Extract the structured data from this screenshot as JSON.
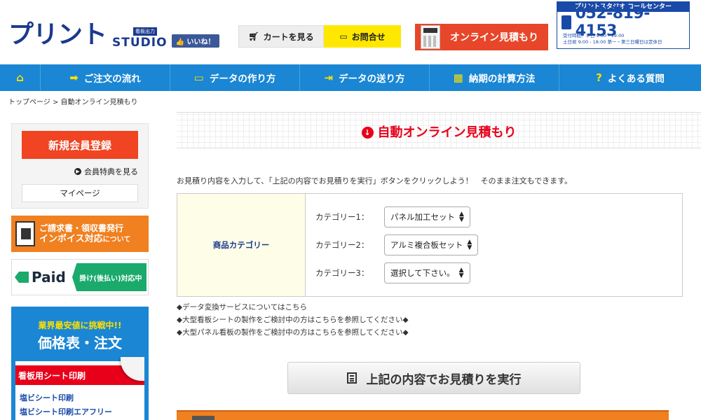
{
  "header": {
    "logo_text": "プリント",
    "logo_badge": "看板出力",
    "logo_studio": "STUDIO",
    "like_label": "いいね！",
    "cart_label": "カートを見る",
    "contact_label": "お問合せ",
    "quote_label": "オンライン見積もり",
    "callcenter": {
      "title": "プリントスタジオ コールセンター",
      "phone": "052-819-4153",
      "hours_line1": "受付時間：平日 9:00 - 19:00",
      "hours_line2": "土日祝 9:00 - 18:00  第一・第三日曜日は定休日"
    }
  },
  "nav": {
    "items": [
      {
        "label": "ご注文の流れ",
        "icon": "➡"
      },
      {
        "label": "データの作り方",
        "icon": "▭"
      },
      {
        "label": "データの送り方",
        "icon": "⇥"
      },
      {
        "label": "納期の計算方法",
        "icon": "▦"
      },
      {
        "label": "よくある質問",
        "icon": "?"
      }
    ]
  },
  "breadcrumb": "トップページ  >  自動オンライン見積もり",
  "sidebar": {
    "register_label": "新規会員登録",
    "benefits_label": "会員特典を見る",
    "mypage_label": "マイページ",
    "invoice_line1": "ご請求書・領収書発行",
    "invoice_line2": "インボイス対応",
    "invoice_line2_small": "について",
    "paid_logo": "Paid",
    "paid_tag": "掛け(後払い)対応中",
    "price_sub": "業界最安値に挑戦中!!",
    "price_title": "価格表・注文",
    "sheet_header": "看板用シート印刷",
    "price_links": [
      "塩ビシート印刷",
      "塩ビシート印刷エアフリー"
    ]
  },
  "main": {
    "title": "自動オンライン見積もり",
    "instruction": "お見積り内容を入力して、「上記の内容でお見積りを実行」ボタンをクリックしよう！　そのまま注文もできます。",
    "category_header": "商品カテゴリー",
    "categories": [
      {
        "label": "カテゴリー1：",
        "value": "パネル加工セット"
      },
      {
        "label": "カテゴリー2：",
        "value": "アルミ複合板セット"
      },
      {
        "label": "カテゴリー3：",
        "value": "選択して下さい。"
      }
    ],
    "notes": [
      "◆データ変換サービスについてはこちら",
      "◆大型看板シートの製作をご検討中の方はこちらを参照してください◆",
      "◆大型パネル看板の製作をご検討中の方はこちらを参照してください◆"
    ],
    "exec_label": "上記の内容でお見積りを実行"
  },
  "colors": {
    "nav_blue": "#1a86d4",
    "accent_red": "#e8001a",
    "yellow": "#ffe800",
    "orange": "#f08020"
  }
}
